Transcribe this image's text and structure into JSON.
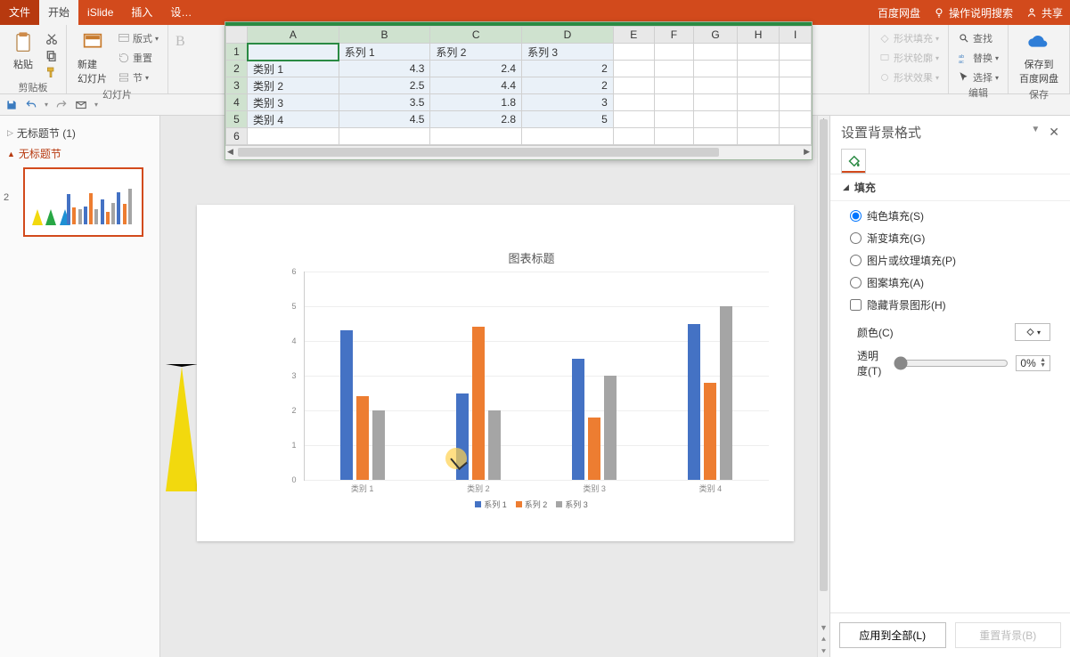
{
  "tabs": {
    "file": "文件",
    "home": "开始",
    "islide": "iSlide",
    "insert": "插入",
    "design": "设…"
  },
  "titlebar_right": {
    "baidu": "百度网盘",
    "help_placeholder": "操作说明搜索",
    "share": "共享"
  },
  "ribbon": {
    "clipboard": {
      "paste": "粘贴",
      "group": "剪贴板"
    },
    "slides": {
      "new": "新建\n幻灯片",
      "layout": "版式",
      "reset": "重置",
      "section": "节",
      "group": "幻灯片"
    },
    "shape": {
      "fill": "形状填充",
      "outline": "形状轮廓",
      "effects": "形状效果"
    },
    "editing": {
      "find": "查找",
      "replace": "替换",
      "select": "选择",
      "group": "编辑"
    },
    "baidu": {
      "save": "保存到\n百度网盘",
      "group": "保存"
    }
  },
  "outline": {
    "untitled_section_1": "无标题节 (1)",
    "untitled_section": "无标题节",
    "slidenum": "2"
  },
  "sheet": {
    "cols": [
      "A",
      "B",
      "C",
      "D",
      "E",
      "F",
      "G",
      "H",
      "I"
    ],
    "rows": [
      "1",
      "2",
      "3",
      "4",
      "5",
      "6"
    ],
    "headers": [
      "",
      "系列 1",
      "系列 2",
      "系列 3"
    ],
    "data": [
      [
        "类别 1",
        "4.3",
        "2.4",
        "2"
      ],
      [
        "类别 2",
        "2.5",
        "4.4",
        "2"
      ],
      [
        "类别 3",
        "3.5",
        "1.8",
        "3"
      ],
      [
        "类别 4",
        "4.5",
        "2.8",
        "5"
      ]
    ]
  },
  "pane": {
    "title": "设置背景格式",
    "fill": "填充",
    "solid": "纯色填充(S)",
    "gradient": "渐变填充(G)",
    "picture": "图片或纹理填充(P)",
    "pattern": "图案填充(A)",
    "hide": "隐藏背景图形(H)",
    "color": "颜色(C)",
    "opacity": "透明度(T)",
    "opacity_val": "0%",
    "apply_all": "应用到全部(L)",
    "reset": "重置背景(B)"
  },
  "chart_data": {
    "type": "bar",
    "title": "图表标题",
    "categories": [
      "类别 1",
      "类别 2",
      "类别 3",
      "类别 4"
    ],
    "series": [
      {
        "name": "系列 1",
        "values": [
          4.3,
          2.5,
          3.5,
          4.5
        ],
        "color": "#4472c4"
      },
      {
        "name": "系列 2",
        "values": [
          2.4,
          4.4,
          1.8,
          2.8
        ],
        "color": "#ed7d31"
      },
      {
        "name": "系列 3",
        "values": [
          2,
          2,
          3,
          5
        ],
        "color": "#a5a5a5"
      }
    ],
    "ylim": [
      0,
      6
    ],
    "yticks": [
      0,
      1,
      2,
      3,
      4,
      5,
      6
    ]
  },
  "colors": {
    "accent": "#d24a1c",
    "series1": "#4472c4",
    "series2": "#ed7d31",
    "series3": "#a5a5a5",
    "tri_y": "#f2d90e",
    "tri_g": "#28a745",
    "tri_b": "#1e90d4"
  }
}
